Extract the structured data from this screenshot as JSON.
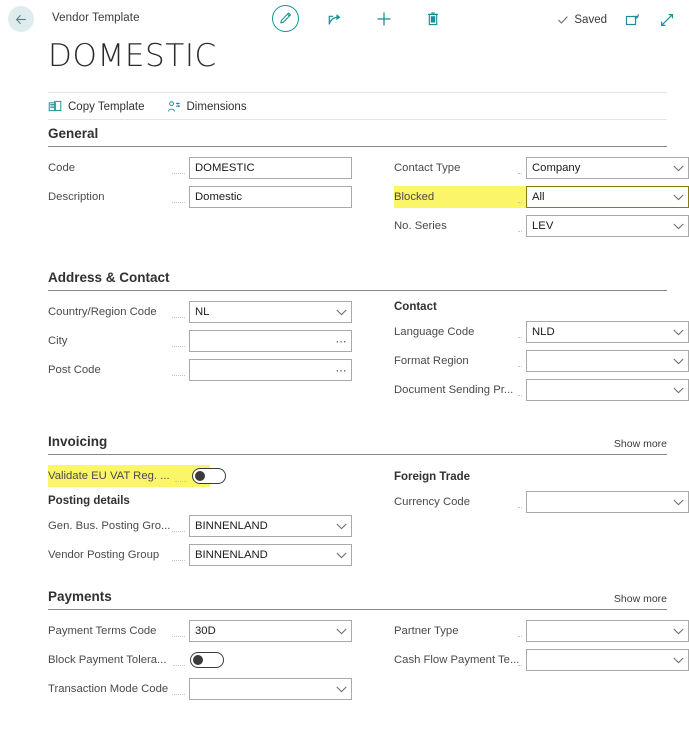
{
  "header": {
    "back_icon": "back-arrow-icon",
    "breadcrumb": "Vendor Template",
    "actions": [
      {
        "name": "edit-pencil",
        "icon": "pencil-icon"
      },
      {
        "name": "share",
        "icon": "share-icon"
      },
      {
        "name": "new",
        "icon": "plus-icon"
      },
      {
        "name": "delete",
        "icon": "trash-icon"
      }
    ],
    "saved_label": "Saved",
    "saved_icon": "checkmark-icon",
    "popout_icon": "open-in-new-window-icon",
    "expand_icon": "expand-diagonal-icon"
  },
  "title": "DOMESTIC",
  "ribbon": [
    {
      "label": "Copy Template",
      "icon": "copy-icon"
    },
    {
      "label": "Dimensions",
      "icon": "dimensions-icon"
    }
  ],
  "colors": {
    "accent": "#1a8f96",
    "highlight": "#fbf56a",
    "highlight_border": "#8a7a14",
    "text": "#323130",
    "label": "#4a4a4a"
  },
  "general": {
    "title": "General",
    "left": [
      {
        "label": "Code",
        "value": "DOMESTIC",
        "type": "text"
      },
      {
        "label": "Description",
        "value": "Domestic",
        "type": "text"
      }
    ],
    "right": [
      {
        "label": "Contact Type",
        "value": "Company",
        "type": "dropdown",
        "highlight": false
      },
      {
        "label": "Blocked",
        "value": "All",
        "type": "dropdown",
        "highlight": true
      },
      {
        "label": "No. Series",
        "value": "LEV",
        "type": "dropdown",
        "highlight": false
      }
    ]
  },
  "address_contact": {
    "title": "Address & Contact",
    "left": [
      {
        "label": "Country/Region Code",
        "value": "NL",
        "type": "dropdown"
      },
      {
        "label": "City",
        "value": "",
        "type": "lookup"
      },
      {
        "label": "Post Code",
        "value": "",
        "type": "lookup"
      }
    ],
    "right_subhead": "Contact",
    "right": [
      {
        "label": "Language Code",
        "value": "NLD",
        "type": "dropdown"
      },
      {
        "label": "Format Region",
        "value": "",
        "type": "dropdown"
      },
      {
        "label": "Document Sending Pr...",
        "value": "",
        "type": "dropdown"
      }
    ]
  },
  "invoicing": {
    "title": "Invoicing",
    "show_more": "Show more",
    "toggle_field": {
      "label": "Validate EU VAT Reg. ...",
      "state": "off",
      "highlight": true
    },
    "posting_subhead": "Posting details",
    "left": [
      {
        "label": "Gen. Bus. Posting Gro...",
        "value": "BINNENLAND",
        "type": "dropdown"
      },
      {
        "label": "Vendor Posting Group",
        "value": "BINNENLAND",
        "type": "dropdown"
      }
    ],
    "right_subhead": "Foreign Trade",
    "right": [
      {
        "label": "Currency Code",
        "value": "",
        "type": "dropdown"
      }
    ]
  },
  "payments": {
    "title": "Payments",
    "show_more": "Show more",
    "left": [
      {
        "label": "Payment Terms Code",
        "value": "30D",
        "type": "dropdown"
      },
      {
        "label": "Block Payment Tolera...",
        "value": "",
        "type": "toggle",
        "state": "off"
      },
      {
        "label": "Transaction Mode Code",
        "value": "",
        "type": "dropdown"
      }
    ],
    "right": [
      {
        "label": "Partner Type",
        "value": "",
        "type": "dropdown"
      },
      {
        "label": "Cash Flow Payment Te...",
        "value": "",
        "type": "dropdown"
      }
    ]
  }
}
